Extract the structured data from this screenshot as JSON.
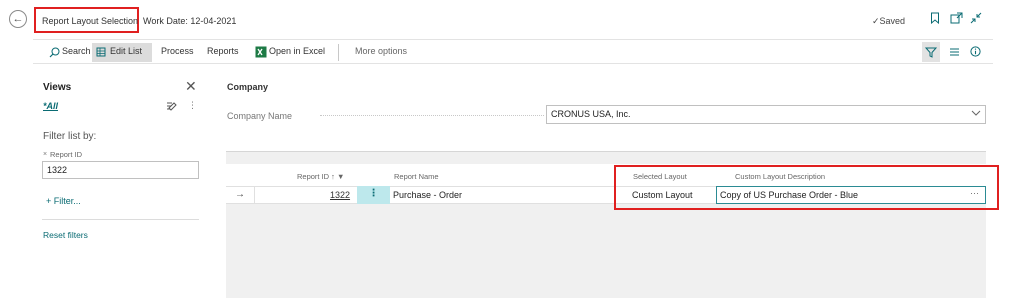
{
  "header": {
    "back_icon": "←",
    "title": "Report Layout Selection",
    "work_date": "Work Date: 12-04-2021",
    "saved": "✓Saved",
    "icons": [
      "bookmark-icon",
      "open-new-window-icon",
      "collapse-icon"
    ]
  },
  "actions": {
    "search": "Search",
    "edit_list": "Edit List",
    "process": "Process",
    "reports": "Reports",
    "open_in_excel": "Open in Excel",
    "more_options": "More options",
    "right_icons": [
      "filter-icon",
      "list-view-icon",
      "info-icon"
    ]
  },
  "sidebar": {
    "views_title": "Views",
    "close_icon": "✕",
    "view_all": "*All",
    "filter_list_by": "Filter list by:",
    "filter_chip_x": "×",
    "filter_chip_label": "Report ID",
    "filter_value": "1322",
    "add_filter": "+ Filter...",
    "reset_filters": "Reset filters"
  },
  "company": {
    "heading": "Company",
    "label": "Company Name",
    "value": "CRONUS USA, Inc."
  },
  "table": {
    "columns": {
      "report_id": "Report ID ↑ ▼",
      "report_name": "Report Name",
      "selected_layout": "Selected Layout",
      "custom_layout_description": "Custom Layout Description"
    },
    "rows": [
      {
        "arrow": "→",
        "report_id": "1322",
        "menu": "⋮",
        "report_name": "Purchase - Order",
        "selected_layout": "Custom Layout",
        "custom_layout_description": "Copy of US Purchase Order - Blue",
        "more": "···"
      }
    ]
  },
  "colors": {
    "accent": "#0a6b73",
    "highlight_red": "#e02020",
    "selected_cell": "#bde8ec"
  }
}
